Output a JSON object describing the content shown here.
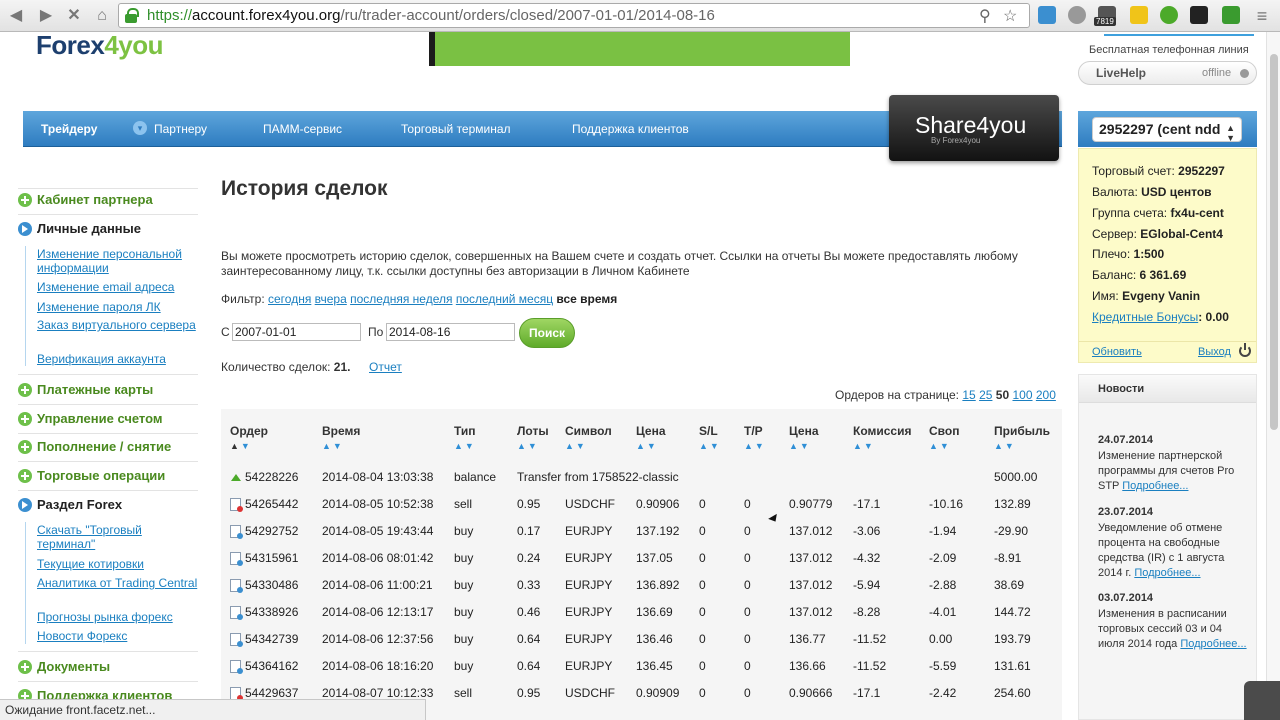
{
  "browser": {
    "url_scheme": "https://",
    "url_host": "account.forex4you.org",
    "url_path": "/ru/trader-account/orders/closed/2007-01-01/2014-08-16",
    "ext_badge": "7819",
    "status_text": "Ожидание front.facetz.net..."
  },
  "header": {
    "logo_main": "Forex",
    "logo_four": "4you",
    "free_line": "Бесплатная телефонная линия",
    "livehelp_label": "LiveHelp",
    "livehelp_status": "offline"
  },
  "nav": {
    "items": [
      "Трейдеру",
      "Партнеру",
      "ПАММ-сервис",
      "Торговый терминал",
      "Поддержка клиентов"
    ],
    "share_title": "Share4you",
    "share_sub": "By Forex4you",
    "account_selected": "2952297 (cent ndd"
  },
  "account": {
    "rows": [
      {
        "label": "Торговый счет:",
        "value": "2952297"
      },
      {
        "label": "Валюта:",
        "value": "USD центов"
      },
      {
        "label": "Группа счета:",
        "value": "fx4u-cent"
      },
      {
        "label": "Сервер:",
        "value": "EGlobal-Cent4"
      },
      {
        "label": "Плечо:",
        "value": "1:500"
      },
      {
        "label": "Баланс:",
        "value": "6 361.69"
      },
      {
        "label": "Имя:",
        "value": "Evgeny Vanin"
      }
    ],
    "bonus_label": "Кредитные Бонусы",
    "bonus_value": ": 0.00",
    "refresh": "Обновить",
    "logout": "Выход"
  },
  "news": {
    "title": "Новости",
    "items": [
      {
        "date": "24.07.2014",
        "text": "Изменение партнерской программы для счетов Pro STP ",
        "more": "Подробнее..."
      },
      {
        "date": "23.07.2014",
        "text": "Уведомление об отмене процента на свободные средства (IR) с 1 августа 2014 г. ",
        "more": "Подробнее..."
      },
      {
        "date": "03.07.2014",
        "text": "Изменения в расписании торговых сессий 03 и 04 июля 2014 года ",
        "more": "Подробнее..."
      }
    ]
  },
  "sidebar": {
    "sections": [
      {
        "label": "Кабинет партнера",
        "open": false
      },
      {
        "label": "Личные данные",
        "open": true
      },
      {
        "label": "Платежные карты",
        "open": false
      },
      {
        "label": "Управление счетом",
        "open": false
      },
      {
        "label": "Пополнение / снятие",
        "open": false
      },
      {
        "label": "Торговые операции",
        "open": false
      },
      {
        "label": "Раздел Forex",
        "open": true
      },
      {
        "label": "Документы",
        "open": false
      },
      {
        "label": "Поддержка клиентов",
        "open": false
      }
    ],
    "personal_links": [
      "Изменение персональной информации",
      "Изменение email адреса",
      "Изменение пароля ЛК",
      "Заказ виртуального сервера",
      "Верификация аккаунта"
    ],
    "forex_links": [
      "Скачать \"Торговый терминал\"",
      "Текущие котировки",
      "Аналитика от Trading Central",
      "Прогнозы рынка форекс",
      "Новости Форекс"
    ]
  },
  "page": {
    "title": "История сделок",
    "intro": "Вы можете просмотреть историю сделок, совершенных на Вашем счете и создать отчет. Ссылки на отчеты Вы можете предоставлять любому заинтересованному лицу, т.к. ссылки доступны без авторизации в Личном Кабинете",
    "filter_label": "Фильтр:",
    "filters": [
      "сегодня",
      "вчера",
      "последняя неделя",
      "последний месяц"
    ],
    "filter_active": "все время",
    "from_label": "С",
    "from_value": "2007-01-01",
    "to_label": "По",
    "to_value": "2014-08-16",
    "search_label": "Поиск",
    "count_label": "Количество сделок:",
    "count_value": "21.",
    "report_link": "Отчет",
    "perpage_label": "Ордеров на странице:",
    "perpage": [
      "15",
      "25",
      "50",
      "100",
      "200"
    ],
    "perpage_active": "50"
  },
  "table": {
    "columns": [
      "Ордер",
      "Время",
      "Тип",
      "Лоты",
      "Символ",
      "Цена",
      "S/L",
      "T/P",
      "Цена",
      "Комиссия",
      "Своп",
      "Прибыль"
    ],
    "rows": [
      {
        "order": "54228226",
        "time": "2014-08-04 13:03:38",
        "type": "balance",
        "comment": "Transfer from 1758522-classic",
        "profit": "5000.00"
      },
      {
        "order": "54265442",
        "time": "2014-08-05 10:52:38",
        "type": "sell",
        "lots": "0.95",
        "symbol": "USDCHF",
        "price": "0.90906",
        "sl": "0",
        "tp": "0",
        "close": "0.90779",
        "commission": "-17.1",
        "swap": "-10.16",
        "profit": "132.89"
      },
      {
        "order": "54292752",
        "time": "2014-08-05 19:43:44",
        "type": "buy",
        "lots": "0.17",
        "symbol": "EURJPY",
        "price": "137.192",
        "sl": "0",
        "tp": "0",
        "close": "137.012",
        "commission": "-3.06",
        "swap": "-1.94",
        "profit": "-29.90"
      },
      {
        "order": "54315961",
        "time": "2014-08-06 08:01:42",
        "type": "buy",
        "lots": "0.24",
        "symbol": "EURJPY",
        "price": "137.05",
        "sl": "0",
        "tp": "0",
        "close": "137.012",
        "commission": "-4.32",
        "swap": "-2.09",
        "profit": "-8.91"
      },
      {
        "order": "54330486",
        "time": "2014-08-06 11:00:21",
        "type": "buy",
        "lots": "0.33",
        "symbol": "EURJPY",
        "price": "136.892",
        "sl": "0",
        "tp": "0",
        "close": "137.012",
        "commission": "-5.94",
        "swap": "-2.88",
        "profit": "38.69"
      },
      {
        "order": "54338926",
        "time": "2014-08-06 12:13:17",
        "type": "buy",
        "lots": "0.46",
        "symbol": "EURJPY",
        "price": "136.69",
        "sl": "0",
        "tp": "0",
        "close": "137.012",
        "commission": "-8.28",
        "swap": "-4.01",
        "profit": "144.72"
      },
      {
        "order": "54342739",
        "time": "2014-08-06 12:37:56",
        "type": "buy",
        "lots": "0.64",
        "symbol": "EURJPY",
        "price": "136.46",
        "sl": "0",
        "tp": "0",
        "close": "136.77",
        "commission": "-11.52",
        "swap": "0.00",
        "profit": "193.79"
      },
      {
        "order": "54364162",
        "time": "2014-08-06 18:16:20",
        "type": "buy",
        "lots": "0.64",
        "symbol": "EURJPY",
        "price": "136.45",
        "sl": "0",
        "tp": "0",
        "close": "136.66",
        "commission": "-11.52",
        "swap": "-5.59",
        "profit": "131.61"
      },
      {
        "order": "54429637",
        "time": "2014-08-07 10:12:33",
        "type": "sell",
        "lots": "0.95",
        "symbol": "USDCHF",
        "price": "0.90909",
        "sl": "0",
        "tp": "0",
        "close": "0.90666",
        "commission": "-17.1",
        "swap": "-2.42",
        "profit": "254.60"
      }
    ]
  },
  "colors": {
    "nav_blue": "#2e7cc0",
    "link_blue": "#1a7fc0",
    "green_accent": "#6ec04a",
    "info_yellow": "#fdfbc9"
  }
}
